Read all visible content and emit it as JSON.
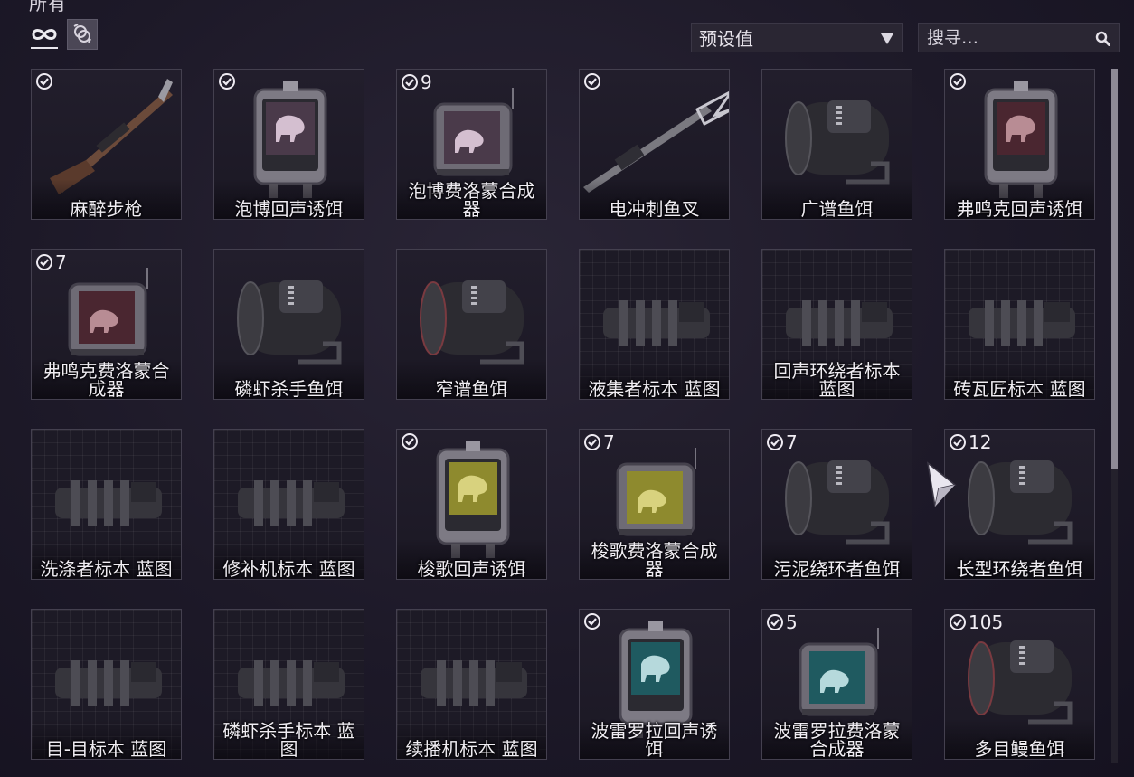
{
  "header": {
    "title": "所有"
  },
  "filters": {
    "all_icon": "infinity-icon",
    "crafted_icon": "crafting-ring-icon"
  },
  "preset": {
    "label": "预设值"
  },
  "search": {
    "placeholder": "搜寻…"
  },
  "colors": {
    "accent": "#e9e6ee",
    "background": "#1d1928",
    "card_border": "#44404f"
  },
  "items": [
    {
      "name": "麻醉步枪",
      "checked": true,
      "count": "",
      "kind": "rifle"
    },
    {
      "name": "泡博回声诱饵",
      "checked": true,
      "count": "",
      "kind": "lure-pink"
    },
    {
      "name": "泡博费洛蒙合成器",
      "checked": true,
      "count": "9",
      "kind": "synth-pink"
    },
    {
      "name": "电冲刺鱼叉",
      "checked": true,
      "count": "",
      "kind": "spear"
    },
    {
      "name": "广谱鱼饵",
      "checked": false,
      "count": "",
      "kind": "bait"
    },
    {
      "name": "弗鸣克回声诱饵",
      "checked": true,
      "count": "",
      "kind": "lure-red"
    },
    {
      "name": "弗鸣克费洛蒙合成器",
      "checked": true,
      "count": "7",
      "kind": "synth-red"
    },
    {
      "name": "磷虾杀手鱼饵",
      "checked": false,
      "count": "",
      "kind": "bait"
    },
    {
      "name": "窄谱鱼饵",
      "checked": false,
      "count": "",
      "kind": "bait-red"
    },
    {
      "name": "液集者标本 蓝图",
      "checked": false,
      "count": "",
      "kind": "blueprint"
    },
    {
      "name": "回声环绕者标本 蓝图",
      "checked": false,
      "count": "",
      "kind": "blueprint"
    },
    {
      "name": "砖瓦匠标本 蓝图",
      "checked": false,
      "count": "",
      "kind": "blueprint"
    },
    {
      "name": "洗涤者标本 蓝图",
      "checked": false,
      "count": "",
      "kind": "blueprint"
    },
    {
      "name": "修补机标本 蓝图",
      "checked": false,
      "count": "",
      "kind": "blueprint"
    },
    {
      "name": "梭歌回声诱饵",
      "checked": true,
      "count": "",
      "kind": "lure-yellow"
    },
    {
      "name": "梭歌费洛蒙合成器",
      "checked": true,
      "count": "7",
      "kind": "synth-yellow"
    },
    {
      "name": "污泥绕环者鱼饵",
      "checked": true,
      "count": "7",
      "kind": "bait"
    },
    {
      "name": "长型环绕者鱼饵",
      "checked": true,
      "count": "12",
      "kind": "bait"
    },
    {
      "name": "目-目标本 蓝图",
      "checked": false,
      "count": "",
      "kind": "blueprint"
    },
    {
      "name": "磷虾杀手标本 蓝图",
      "checked": false,
      "count": "",
      "kind": "blueprint"
    },
    {
      "name": "续播机标本 蓝图",
      "checked": false,
      "count": "",
      "kind": "blueprint"
    },
    {
      "name": "波雷罗拉回声诱饵",
      "checked": true,
      "count": "",
      "kind": "lure-teal"
    },
    {
      "name": "波雷罗拉费洛蒙合成器",
      "checked": true,
      "count": "5",
      "kind": "synth-teal"
    },
    {
      "name": "多目鳗鱼饵",
      "checked": true,
      "count": "105",
      "kind": "bait-red"
    }
  ]
}
